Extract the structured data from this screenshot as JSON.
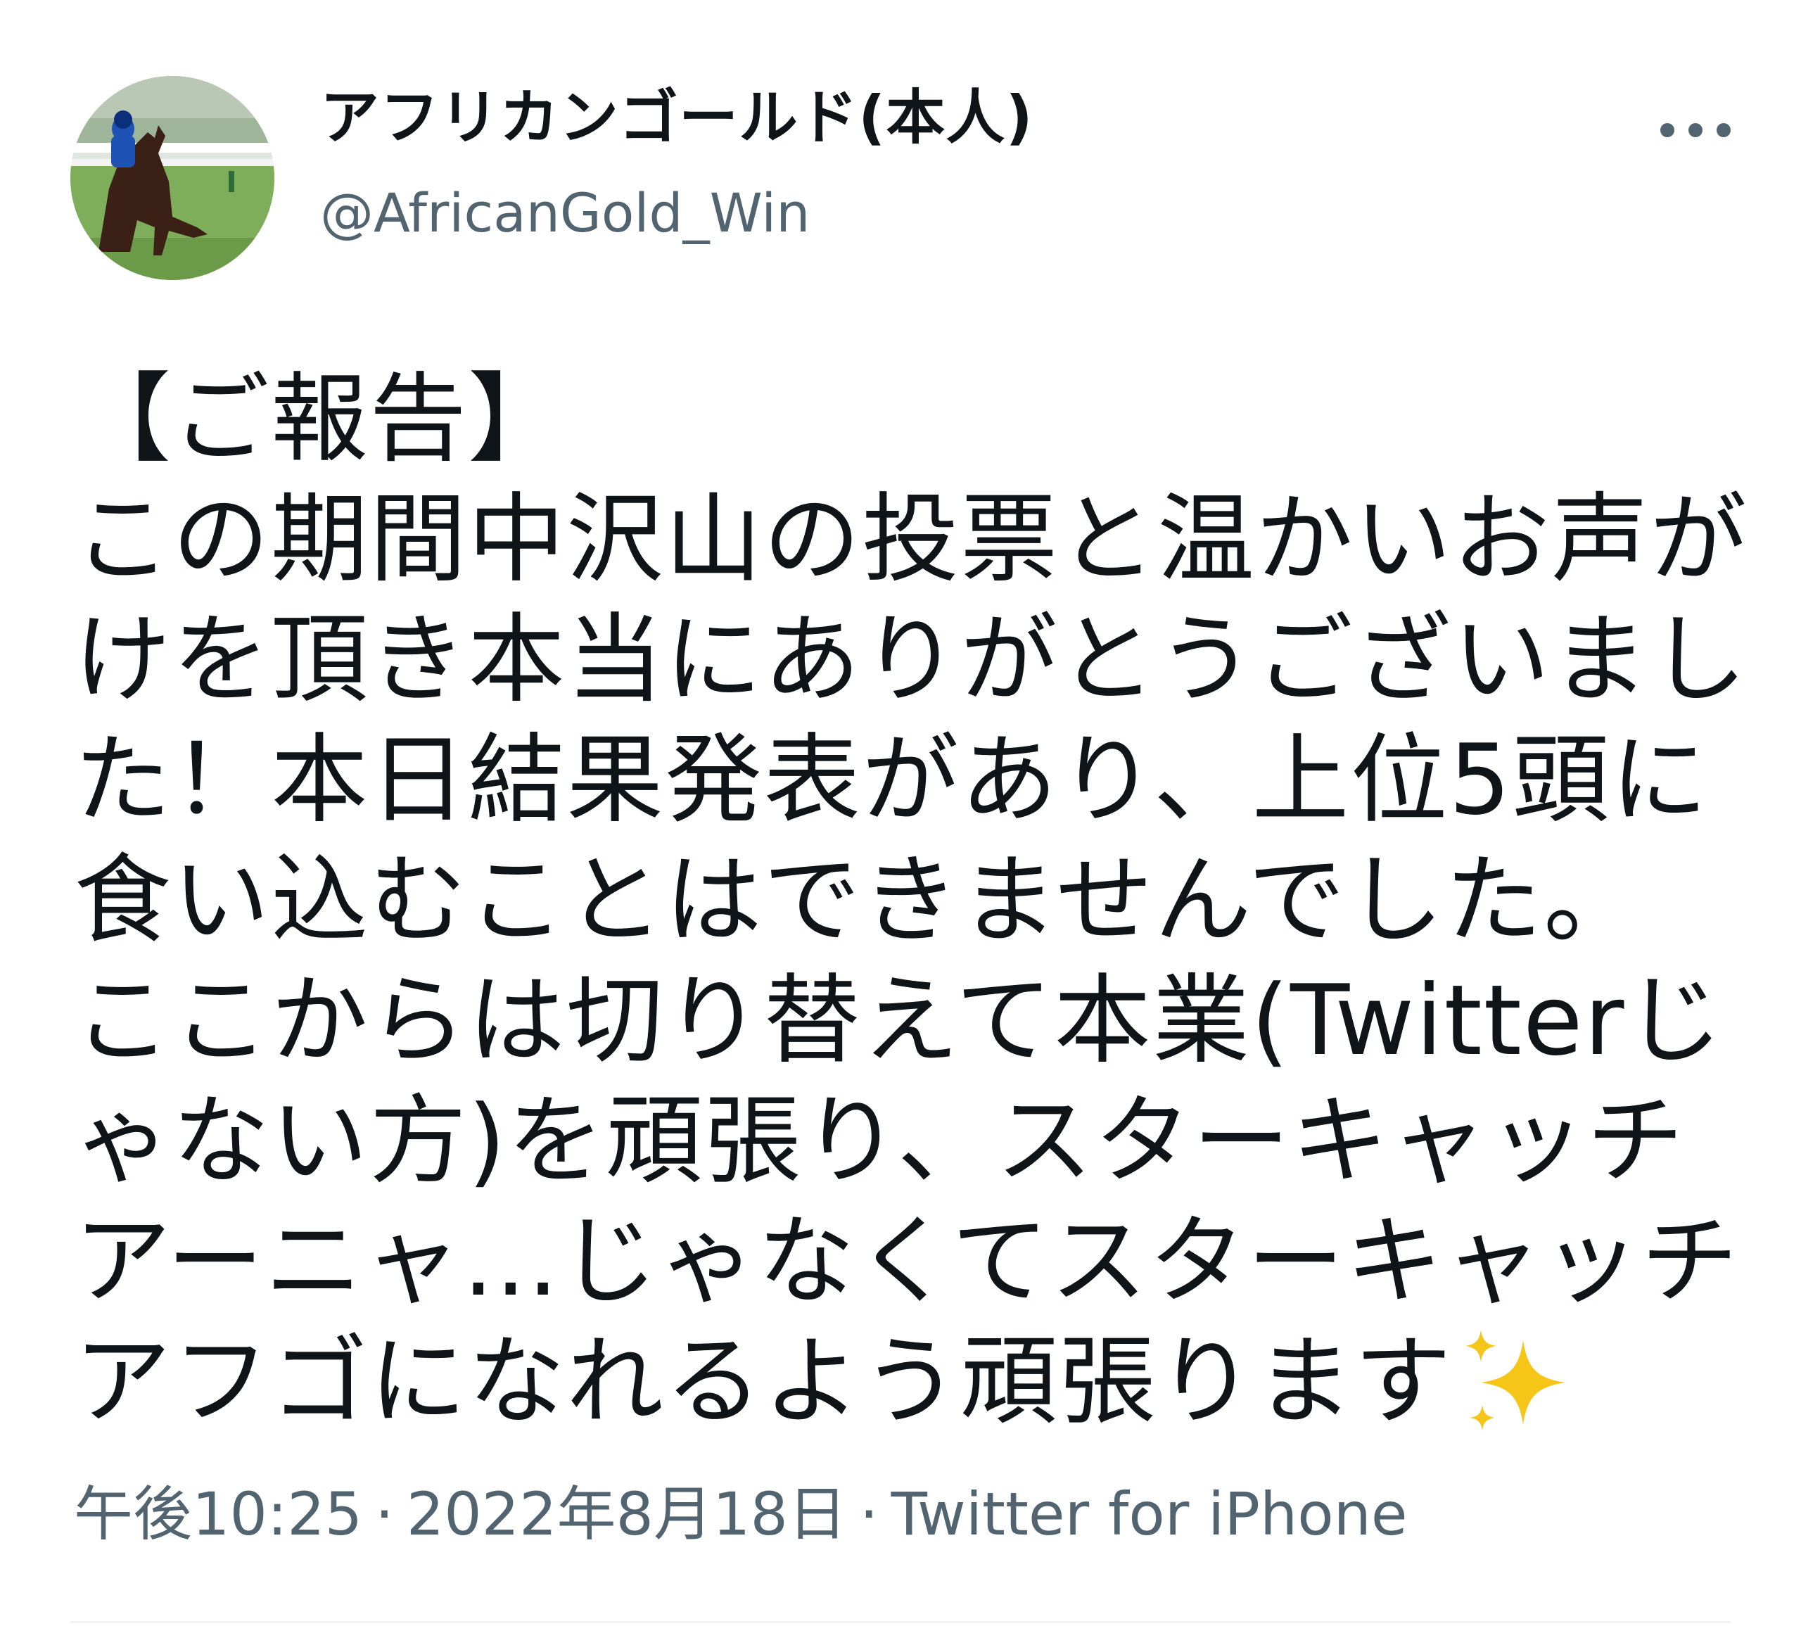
{
  "tweet": {
    "author": {
      "display_name": "アフリカンゴールド(本人)",
      "handle": "@AfricanGold_Win",
      "avatar_icon": "horse-rider-avatar"
    },
    "more_icon": "more-dots-icon",
    "body_lines": [
      "【ご報告】",
      "この期間中沢山の投票と温かいお声が",
      "けを頂き本当にありがとうございまし",
      "た！本日結果発表があり、上位5頭に",
      "食い込むことはできませんでした。",
      "ここからは切り替えて本業(Twitterじ",
      "ゃない方)を頑張り、スターキャッチ",
      "アーニャ…じゃなくてスターキャッチ",
      "アフゴになれるよう頑張ります"
    ],
    "emoji_icon": "sparkles-icon",
    "time": "午後10:25",
    "date": "2022年8月18日",
    "separator": "·",
    "source": "Twitter for iPhone"
  },
  "colors": {
    "text": "#0f1419",
    "secondary": "#536471",
    "sparkle": "#f5c518",
    "divider": "#eff3f4"
  }
}
